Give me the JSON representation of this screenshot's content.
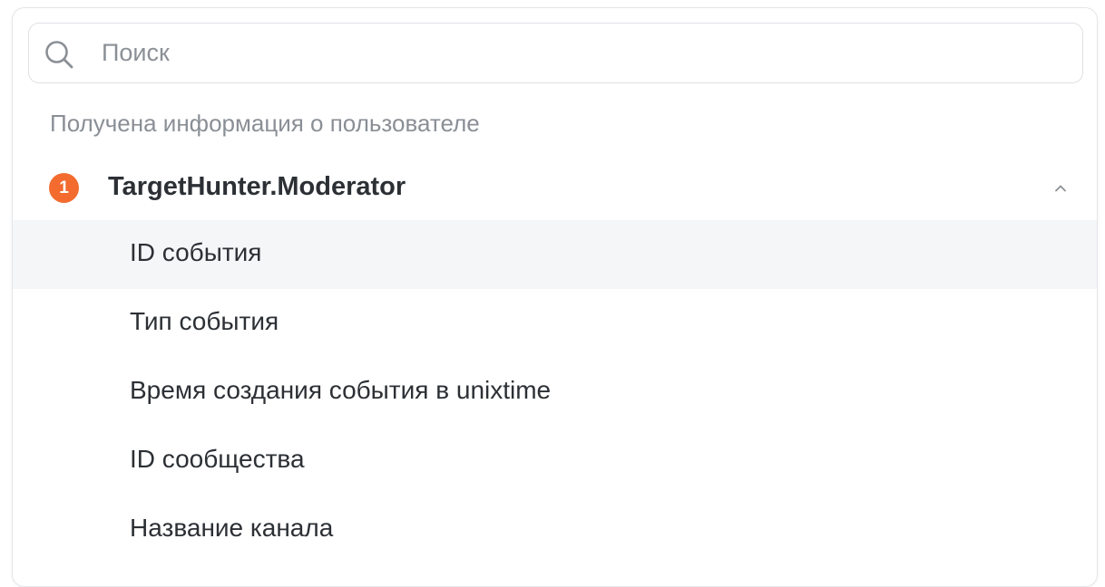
{
  "search": {
    "placeholder": "Поиск",
    "value": ""
  },
  "section": {
    "title": "Получена информация о пользователе"
  },
  "group": {
    "badge_count": "1",
    "title": "TargetHunter.Moderator",
    "expanded": true,
    "badge_color": "#f36b2f"
  },
  "items": [
    {
      "label": "ID события"
    },
    {
      "label": "Тип события"
    },
    {
      "label": "Время создания события в unixtime"
    },
    {
      "label": "ID сообщества"
    },
    {
      "label": "Название канала"
    }
  ]
}
